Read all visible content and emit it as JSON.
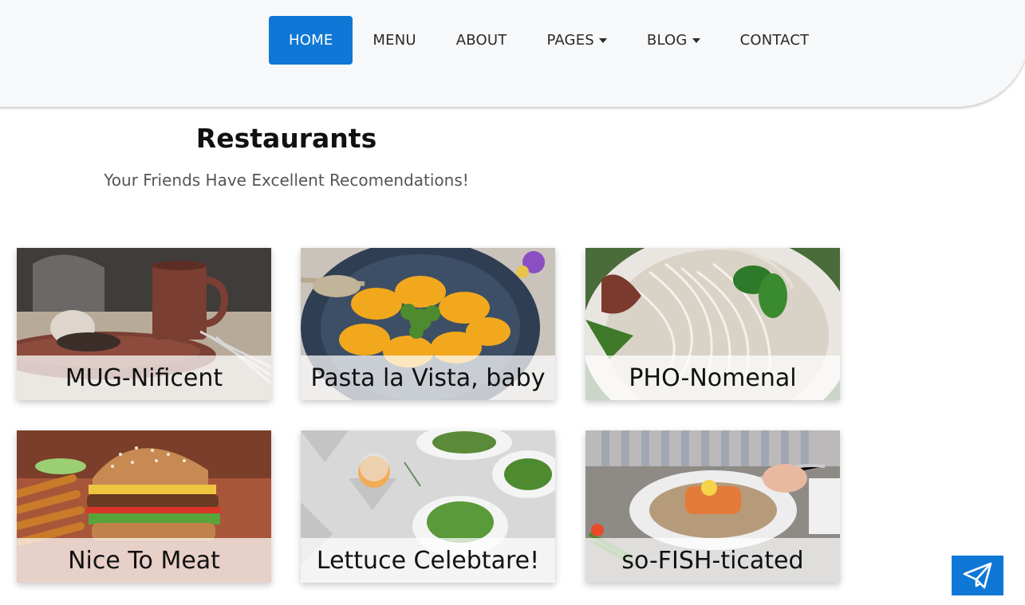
{
  "nav": {
    "items": [
      {
        "label": "HOME",
        "active": true,
        "dropdown": false
      },
      {
        "label": "MENU",
        "active": false,
        "dropdown": false
      },
      {
        "label": "ABOUT",
        "active": false,
        "dropdown": false
      },
      {
        "label": "PAGES",
        "active": false,
        "dropdown": true
      },
      {
        "label": "BLOG",
        "active": false,
        "dropdown": true
      },
      {
        "label": "CONTACT",
        "active": false,
        "dropdown": false
      }
    ]
  },
  "section": {
    "title": "Restaurants",
    "subtitle": "Your Friends Have Excellent Recomendations!"
  },
  "cards": [
    {
      "caption": "MUG-Nificent"
    },
    {
      "caption": "Pasta la Vista, baby"
    },
    {
      "caption": "PHO-Nomenal"
    },
    {
      "caption": "Nice To Meat"
    },
    {
      "caption": "Lettuce Celebtare!"
    },
    {
      "caption": "so-FISH-ticated"
    }
  ],
  "floating_button": {
    "icon": "paper-plane-icon"
  },
  "colors": {
    "accent": "#0f78d6",
    "header_bg": "#f7f8fa"
  }
}
